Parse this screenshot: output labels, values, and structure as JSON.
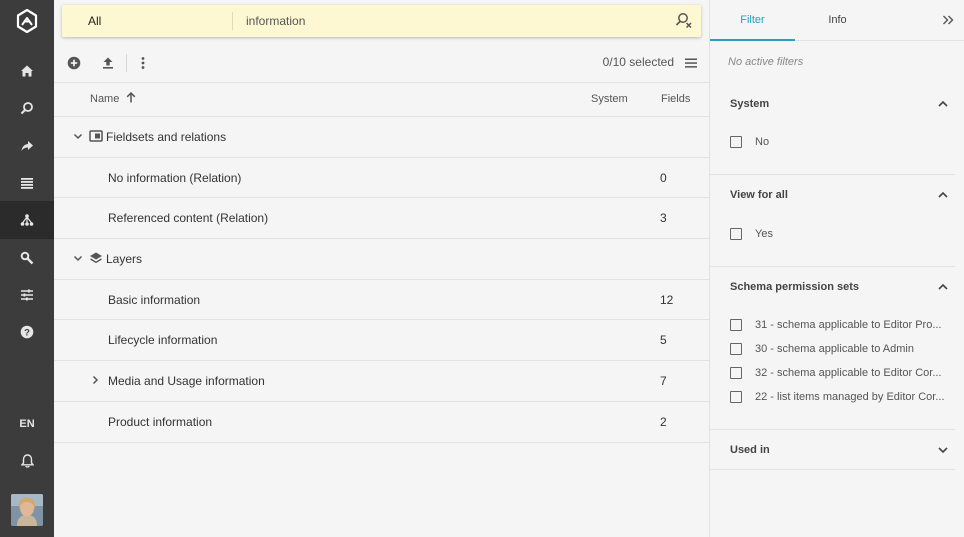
{
  "nav": {
    "language": "EN",
    "items": [
      {
        "icon": "home-icon",
        "active": false
      },
      {
        "icon": "search-icon",
        "active": false
      },
      {
        "icon": "share-icon",
        "active": false
      },
      {
        "icon": "list-icon",
        "active": false
      },
      {
        "icon": "hierarchy-icon",
        "active": true
      },
      {
        "icon": "wrench-icon",
        "active": false
      },
      {
        "icon": "sliders-icon",
        "active": false
      },
      {
        "icon": "help-icon",
        "active": false
      }
    ]
  },
  "search": {
    "scope": "All",
    "query": "information"
  },
  "toolbar": {
    "selected": "0/10 selected"
  },
  "table": {
    "headers": {
      "name": "Name",
      "system": "System",
      "fields": "Fields"
    },
    "rows": [
      {
        "label": "Fieldsets and relations",
        "fields": "",
        "group": true,
        "expanded": true,
        "icon": "fieldset-icon"
      },
      {
        "label": "No information (Relation)",
        "fields": "0",
        "group": false
      },
      {
        "label": "Referenced content (Relation)",
        "fields": "3",
        "group": false
      },
      {
        "label": "Layers",
        "fields": "",
        "group": true,
        "expanded": true,
        "icon": "layers-icon"
      },
      {
        "label": "Basic information",
        "fields": "12",
        "group": false
      },
      {
        "label": "Lifecycle information",
        "fields": "5",
        "group": false
      },
      {
        "label": "Media and Usage information",
        "fields": "7",
        "group": false,
        "expandable": true
      },
      {
        "label": "Product information",
        "fields": "2",
        "group": false
      }
    ]
  },
  "panel": {
    "tabs": {
      "filter": "Filter",
      "info": "Info"
    },
    "no_filters": "No active filters",
    "system": {
      "title": "System",
      "options": [
        "No"
      ]
    },
    "view_for_all": {
      "title": "View for all",
      "options": [
        "Yes"
      ]
    },
    "schema_permission_sets": {
      "title": "Schema permission sets",
      "options": [
        "31 - schema applicable to Editor Pro...",
        "30 - schema applicable to Admin",
        "32 - schema applicable to Editor Cor...",
        "22 - list items managed by Editor Cor..."
      ]
    },
    "used_in": {
      "title": "Used in"
    }
  },
  "colors": {
    "nav_bg": "#3c3c3c",
    "nav_active": "#2b2b2b",
    "search_bg": "#fdf8d2",
    "accent": "#2a9fc3"
  }
}
